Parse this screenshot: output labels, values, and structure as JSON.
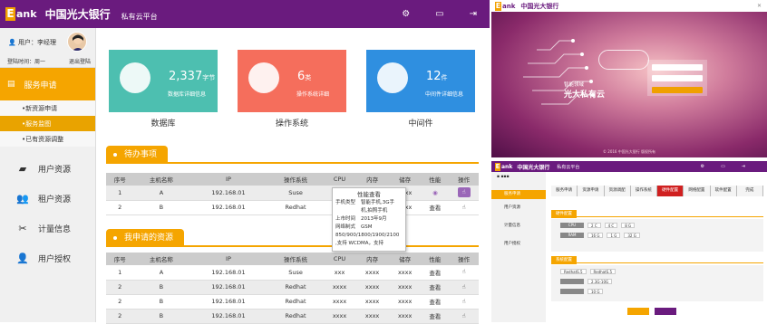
{
  "header": {
    "logo_letter": "E",
    "logo_text": "ank",
    "bank_name": "中国光大银行",
    "platform": "私有云平台",
    "icons": [
      "gear-icon",
      "message-icon",
      "logout-icon"
    ]
  },
  "user": {
    "name_label": "用户：李经理",
    "login_time_label": "登陆时间：周一",
    "logout": "退出登陆"
  },
  "sidebar": {
    "service": {
      "label": "服务申请",
      "icon": "document-icon"
    },
    "sub": [
      {
        "label": "新资源申请"
      },
      {
        "label": "服务监图"
      },
      {
        "label": "已有资源调整"
      }
    ],
    "items": [
      {
        "label": "用户资源",
        "icon": "folder-icon"
      },
      {
        "label": "租户资源",
        "icon": "users-icon"
      },
      {
        "label": "计量信息",
        "icon": "tools-icon"
      },
      {
        "label": "用户授权",
        "icon": "user-auth-icon"
      }
    ]
  },
  "tiles": [
    {
      "num": "2,337",
      "unit": "字节",
      "text": "数据库详细信息",
      "caption": "数据库",
      "color": "#4dbfb0"
    },
    {
      "num": "6",
      "unit": "类",
      "text": "操作系统详细",
      "caption": "操作系统",
      "color": "#f56e5c"
    },
    {
      "num": "12",
      "unit": "件",
      "text": "中间件详细信息",
      "caption": "中间件",
      "color": "#2f8fe0"
    }
  ],
  "todo": {
    "title": "待办事项",
    "columns": [
      "序号",
      "主机名称",
      "IP",
      "操作系统",
      "CPU",
      "内存",
      "储存",
      "性能",
      "操作"
    ],
    "rows": [
      [
        "1",
        "A",
        "192.168.01",
        "Suse",
        "xxx",
        "xxxx",
        "xxxx",
        "",
        ""
      ],
      [
        "2",
        "B",
        "192.168.01",
        "Redhat",
        "xxxx",
        "xxxx",
        "xxxx",
        "查看",
        ""
      ]
    ]
  },
  "tooltip": {
    "title": "性能查看",
    "rows": [
      [
        "手机类型",
        "智能手机,3G手"
      ],
      [
        "",
        "机,拍照手机"
      ],
      [
        "上市时间",
        "2013年9月"
      ],
      [
        "网络制式",
        "GSM"
      ],
      [
        "",
        "850/900/1800/1900/2100"
      ],
      [
        "",
        ",支持 WCDMA，支持"
      ]
    ]
  },
  "mine": {
    "title": "我申请的资源",
    "columns": [
      "序号",
      "主机名称",
      "IP",
      "操作系统",
      "CPU",
      "内存",
      "储存",
      "性能",
      "操作"
    ],
    "rows": [
      [
        "1",
        "A",
        "192.168.01",
        "Suse",
        "xxx",
        "xxxx",
        "xxxx",
        "查看",
        ""
      ],
      [
        "2",
        "B",
        "192.168.01",
        "Redhat",
        "xxxx",
        "xxxx",
        "xxxx",
        "查看",
        ""
      ],
      [
        "2",
        "B",
        "192.168.01",
        "Redhat",
        "xxxx",
        "xxxx",
        "xxxx",
        "查看",
        ""
      ],
      [
        "2",
        "B",
        "192.168.01",
        "Redhat",
        "xxxx",
        "xxxx",
        "xxxx",
        "查看",
        ""
      ]
    ]
  },
  "login_preview": {
    "logo_letter": "E",
    "logo_text": "ank",
    "bank_name": "中国光大银行",
    "subtitle": "智能领域",
    "title": "光大私有云",
    "footer": "© 2016 中国光大银行 版权所有"
  },
  "page_preview": {
    "logo_letter": "E",
    "logo_text": "ank",
    "bank_name": "中国光大银行",
    "platform": "私有云平台",
    "menu": [
      "服务申请",
      "用户资源",
      "计量信息",
      "用户授权"
    ],
    "steps": [
      "服务申请",
      "资源申请",
      "资源调配",
      "操作系统",
      "硬件配置",
      "网络配置",
      "软件配置",
      "完成"
    ],
    "sections": [
      "硬件配置",
      "系统配置"
    ],
    "fields": [
      "2 C",
      "4 C",
      "8 G",
      "16 G",
      "1 G",
      "32 G",
      "RedhatS.5",
      "RedhatS.5",
      "2.3G-10G",
      "10 G"
    ]
  }
}
